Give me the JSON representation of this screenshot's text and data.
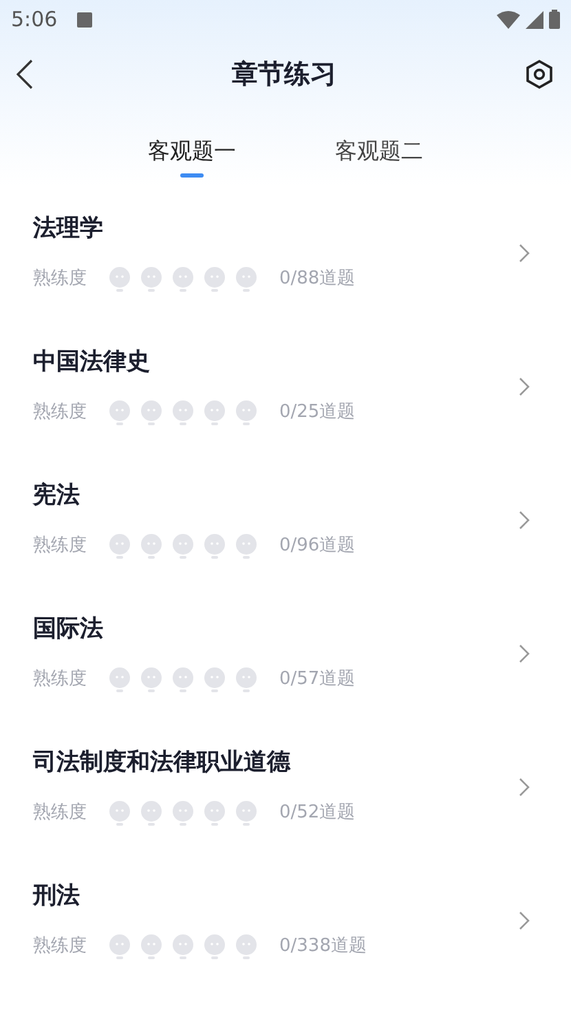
{
  "status_bar": {
    "time": "5:06"
  },
  "header": {
    "title": "章节练习"
  },
  "tabs": [
    {
      "label": "客观题一",
      "selected": true
    },
    {
      "label": "客观题二",
      "selected": false
    }
  ],
  "chapters": [
    {
      "title": "法理学",
      "proficiency_label": "熟练度",
      "stars": 0,
      "count": "0/88道题"
    },
    {
      "title": "中国法律史",
      "proficiency_label": "熟练度",
      "stars": 0,
      "count": "0/25道题"
    },
    {
      "title": "宪法",
      "proficiency_label": "熟练度",
      "stars": 0,
      "count": "0/96道题"
    },
    {
      "title": "国际法",
      "proficiency_label": "熟练度",
      "stars": 0,
      "count": "0/57道题"
    },
    {
      "title": "司法制度和法律职业道德",
      "proficiency_label": "熟练度",
      "stars": 0,
      "count": "0/52道题"
    },
    {
      "title": "刑法",
      "proficiency_label": "熟练度",
      "stars": 0,
      "count": "0/338道题"
    }
  ]
}
